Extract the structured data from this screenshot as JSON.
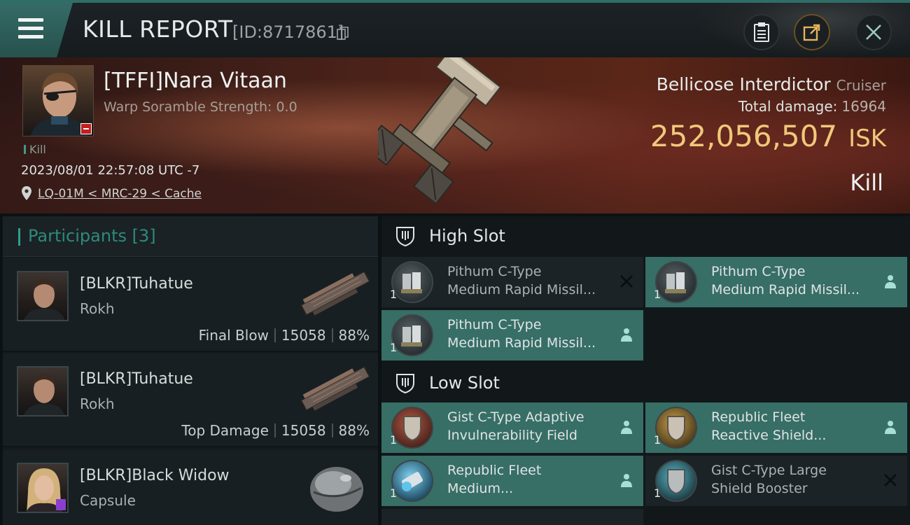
{
  "header": {
    "title": "KILL REPORT",
    "report_id": "[ID:8717861]"
  },
  "victim": {
    "name": "[TFFI]Nara Vitaan",
    "warp_scramble": "Warp Soramble Strength: 0.0",
    "kill_tag": "Kill",
    "timestamp": "2023/08/01 22:57:08 UTC -7",
    "location": "LQ-01M < MRC-29 < Cache"
  },
  "ship": {
    "name": "Bellicose Interdictor",
    "class": "Cruiser",
    "damage_label": "Total damage:",
    "damage_value": "16964",
    "isk_value": "252,056,507",
    "isk_unit": "ISK",
    "kill_type": "Kill"
  },
  "participants": {
    "label": "Participants",
    "count": "[3]",
    "rows": [
      {
        "name": "[BLKR]Tuhatue",
        "ship": "Rokh",
        "role": "Final Blow",
        "damage": "15058",
        "percent": "88%"
      },
      {
        "name": "[BLKR]Tuhatue",
        "ship": "Rokh",
        "role": "Top Damage",
        "damage": "15058",
        "percent": "88%"
      },
      {
        "name": "[BLKR]Black Widow",
        "ship": "Capsule"
      }
    ]
  },
  "fitting": {
    "high_slot_label": "High Slot",
    "low_slot_label": "Low Slot",
    "high_slot": [
      {
        "qty": "1",
        "line1": "Pithum C-Type",
        "line2": "Medium Rapid Missil...",
        "status": "destroyed"
      },
      {
        "qty": "1",
        "line1": "Pithum C-Type",
        "line2": "Medium Rapid Missil...",
        "status": "dropped"
      },
      {
        "qty": "1",
        "line1": "Pithum C-Type",
        "line2": "Medium Rapid Missil...",
        "status": "dropped"
      }
    ],
    "low_slot": [
      {
        "qty": "1",
        "line1": "Gist C-Type Adaptive",
        "line2": "Invulnerability Field",
        "status": "dropped"
      },
      {
        "qty": "1",
        "line1": "Republic Fleet",
        "line2": "Reactive Shield...",
        "status": "dropped"
      },
      {
        "qty": "1",
        "line1": "Republic Fleet",
        "line2": "Medium...",
        "status": "dropped"
      },
      {
        "qty": "1",
        "line1": "Gist C-Type Large",
        "line2": "Shield Booster",
        "status": "destroyed"
      }
    ]
  },
  "colors": {
    "accent_teal": "#376e66",
    "isk_gold": "#f0c87a",
    "participants_teal": "#2f8a7b"
  }
}
